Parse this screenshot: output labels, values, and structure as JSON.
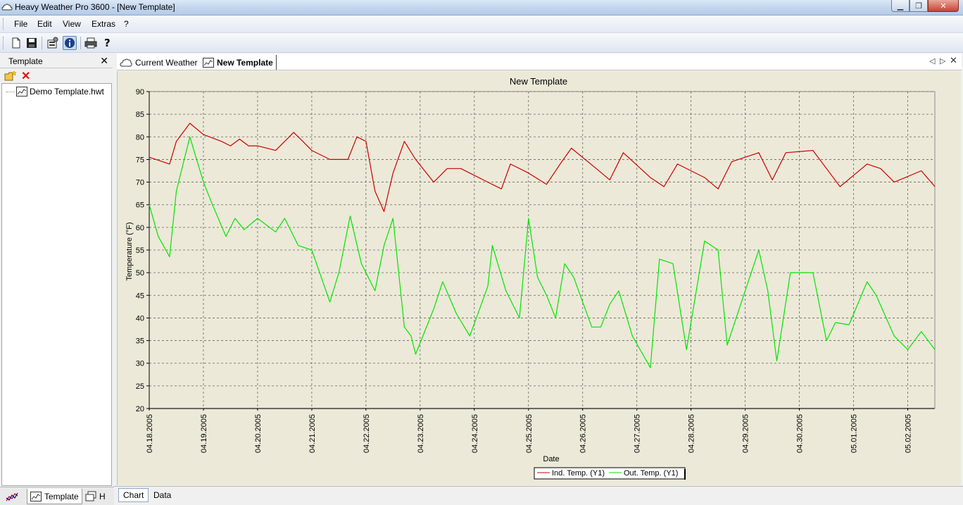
{
  "window": {
    "title": "Heavy Weather Pro 3600 - [New Template]"
  },
  "menu": {
    "items": [
      "File",
      "Edit",
      "View",
      "Extras",
      "?"
    ]
  },
  "left_panel": {
    "header": "Template",
    "tree_items": [
      "Demo Template.hwt"
    ]
  },
  "left_bottom_tabs": {
    "template_label": "Template",
    "third_label": "H"
  },
  "doc_tabs": {
    "current_weather": "Current Weather",
    "new_template": "New Template"
  },
  "bottom_tabs": {
    "chart": "Chart",
    "data": "Data"
  },
  "colors": {
    "indoor": "#cc0000",
    "outdoor": "#00e600",
    "chart_bg": "#ece9d8"
  },
  "chart_data": {
    "type": "line",
    "title": "New Template",
    "xlabel": "Date",
    "ylabel": "Temperature (°F)",
    "ylim": [
      20,
      90
    ],
    "yticks": [
      20,
      25,
      30,
      35,
      40,
      45,
      50,
      55,
      60,
      65,
      70,
      75,
      80,
      85,
      90
    ],
    "xlim": [
      "04.18.2005 00:00",
      "05.02.2005 12:00"
    ],
    "xtick_labels": [
      "04.18.2005",
      "04.19.2005",
      "04.20.2005",
      "04.21.2005",
      "04.22.2005",
      "04.23.2005",
      "04.24.2005",
      "04.25.2005",
      "04.26.2005",
      "04.27.2005",
      "04.28.2005",
      "04.29.2005",
      "04.30.2005",
      "05.01.2005",
      "05.02.2005"
    ],
    "grid": true,
    "legend_position": "bottom-center",
    "series": [
      {
        "name": "Ind. Temp. (Y1)",
        "color": "#cc0000",
        "x": [
          "04.18.2005 00:00",
          "04.18.2005 09:00",
          "04.18.2005 12:00",
          "04.18.2005 18:00",
          "04.19.2005 00:00",
          "04.19.2005 08:00",
          "04.19.2005 12:00",
          "04.19.2005 16:00",
          "04.19.2005 20:00",
          "04.20.2005 00:00",
          "04.20.2005 08:00",
          "04.20.2005 16:00",
          "04.20.2005 20:00",
          "04.21.2005 00:00",
          "04.21.2005 08:00",
          "04.21.2005 16:00",
          "04.21.2005 20:00",
          "04.22.2005 00:00",
          "04.22.2005 04:00",
          "04.22.2005 08:00",
          "04.22.2005 12:00",
          "04.22.2005 17:00",
          "04.22.2005 22:00",
          "04.23.2005 06:00",
          "04.23.2005 12:00",
          "04.23.2005 18:00",
          "04.24.2005 06:00",
          "04.24.2005 12:00",
          "04.24.2005 16:00",
          "04.25.2005 00:00",
          "04.25.2005 08:00",
          "04.25.2005 14:00",
          "04.25.2005 19:00",
          "04.26.2005 06:00",
          "04.26.2005 12:00",
          "04.26.2005 18:00",
          "04.27.2005 06:00",
          "04.27.2005 12:00",
          "04.27.2005 18:00",
          "04.28.2005 06:00",
          "04.28.2005 12:00",
          "04.28.2005 18:00",
          "04.29.2005 06:00",
          "04.29.2005 12:00",
          "04.29.2005 18:00",
          "04.30.2005 06:00",
          "04.30.2005 12:00",
          "04.30.2005 18:00",
          "05.01.2005 06:00",
          "05.01.2005 12:00",
          "05.01.2005 18:00",
          "05.02.2005 06:00",
          "05.02.2005 12:00"
        ],
        "y": [
          75.5,
          74,
          79,
          83,
          80.5,
          79,
          78,
          79.5,
          78,
          78,
          77,
          81,
          79,
          77,
          75,
          75,
          80,
          79,
          68,
          63.5,
          72,
          79,
          75,
          70,
          73,
          73,
          70,
          68.5,
          74,
          72,
          69.5,
          74,
          77.5,
          73,
          70.5,
          76.5,
          71,
          69,
          74,
          71,
          68.5,
          74.5,
          76.5,
          70.5,
          76.5,
          77,
          73,
          69,
          74,
          73,
          70,
          72.5,
          69
        ]
      },
      {
        "name": "Out. Temp. (Y1)",
        "color": "#00e600",
        "x": [
          "04.18.2005 00:00",
          "04.18.2005 04:00",
          "04.18.2005 09:00",
          "04.18.2005 12:00",
          "04.18.2005 18:00",
          "04.19.2005 00:00",
          "04.19.2005 04:00",
          "04.19.2005 10:00",
          "04.19.2005 14:00",
          "04.19.2005 18:00",
          "04.20.2005 00:00",
          "04.20.2005 08:00",
          "04.20.2005 12:00",
          "04.20.2005 18:00",
          "04.21.2005 00:00",
          "04.21.2005 08:00",
          "04.21.2005 12:00",
          "04.21.2005 17:00",
          "04.21.2005 22:00",
          "04.22.2005 04:00",
          "04.22.2005 08:00",
          "04.22.2005 12:00",
          "04.22.2005 17:00",
          "04.22.2005 20:00",
          "04.22.2005 22:00",
          "04.23.2005 06:00",
          "04.23.2005 10:00",
          "04.23.2005 16:00",
          "04.23.2005 22:00",
          "04.24.2005 06:00",
          "04.24.2005 08:00",
          "04.24.2005 14:00",
          "04.24.2005 20:00",
          "04.25.2005 00:00",
          "04.25.2005 04:00",
          "04.25.2005 08:00",
          "04.25.2005 12:00",
          "04.25.2005 16:00",
          "04.25.2005 20:00",
          "04.26.2005 04:00",
          "04.26.2005 08:00",
          "04.26.2005 12:00",
          "04.26.2005 16:00",
          "04.26.2005 22:00",
          "04.27.2005 06:00",
          "04.27.2005 10:00",
          "04.27.2005 16:00",
          "04.27.2005 22:00",
          "04.28.2005 06:00",
          "04.28.2005 12:00",
          "04.28.2005 16:00",
          "04.28.2005 22:00",
          "04.29.2005 06:00",
          "04.29.2005 10:00",
          "04.29.2005 14:00",
          "04.29.2005 20:00",
          "04.30.2005 06:00",
          "04.30.2005 12:00",
          "04.30.2005 16:00",
          "04.30.2005 22:00",
          "05.01.2005 06:00",
          "05.01.2005 10:00",
          "05.01.2005 18:00",
          "05.02.2005 00:00",
          "05.02.2005 06:00",
          "05.02.2005 12:00"
        ],
        "y": [
          65,
          58,
          53.5,
          68,
          80,
          70,
          65,
          58,
          62,
          59.5,
          62,
          59,
          62,
          56,
          55,
          43.5,
          50,
          62.5,
          52,
          46,
          56,
          62,
          38,
          36,
          32,
          42,
          48,
          41,
          36,
          47,
          56,
          46,
          40,
          62,
          49,
          45,
          40,
          52,
          49,
          38,
          38,
          43,
          46,
          36,
          29,
          53,
          52,
          33,
          57,
          55,
          34,
          43,
          55,
          46,
          30.5,
          50,
          50,
          35,
          39,
          38.5,
          48,
          45,
          36,
          33,
          37,
          33
        ]
      }
    ]
  }
}
